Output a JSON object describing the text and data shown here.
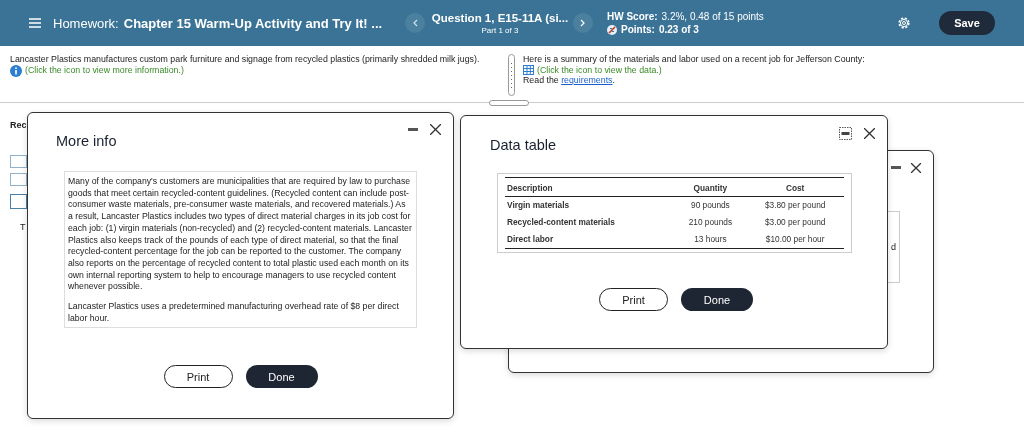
{
  "header": {
    "homework_label": "Homework:",
    "title": "Chapter 15 Warm-Up Activity and Try It! ...",
    "question": "Question 1, E15-11A (si...",
    "part": "Part 1 of 3",
    "score_label": "HW Score:",
    "score": "3.2%, 0.48 of 15 points",
    "points_label": "Points:",
    "points": "0.23 of 3",
    "save": "Save"
  },
  "left_pane": {
    "text": "Lancaster Plastics manufactures custom park furniture and signage from recycled plastics (primarily shredded milk jugs).",
    "hint": "(Click the icon to view more information.)"
  },
  "right_pane": {
    "text": "Here is a summary of the materials and labor used on a recent job for Jefferson County:",
    "hint": "(Click the icon to view the data.)",
    "read_prefix": "Read the ",
    "read_link": "requirements",
    "read_suffix": "."
  },
  "background": {
    "heading": "Rec",
    "answer_boxes": [
      {
        "selected": false
      },
      {
        "selected": false
      },
      {
        "selected": true
      }
    ],
    "label": "T",
    "fragment": "d"
  },
  "more_info": {
    "title": "More info",
    "paragraphs": [
      "Many of the company's customers are municipalities that are required by law to purchase goods that meet certain recycled-content guidelines. (Recycled content can include post-consumer waste materials, pre-consumer waste materials, and recovered materials.) As a result, Lancaster Plastics includes two types of direct material charges in its job cost for each job: (1) virgin materials (non-recycled) and (2) recycled-content materials. Lancaster Plastics also keeps track of the pounds of each type of direct material, so that the final recycled-content percentage for the job can be reported to the customer. The company also reports on the percentage of recycled content to total plastic used each month on its own internal reporting system to help to encourage managers to use recycled content whenever possible.",
      "Lancaster Plastics uses a predetermined manufacturing overhead rate of $8 per direct labor hour."
    ],
    "print": "Print",
    "done": "Done"
  },
  "data_table": {
    "title": "Data table",
    "columns": [
      "Description",
      "Quantity",
      "Cost"
    ],
    "rows": [
      [
        "Virgin materials",
        "90 pounds",
        "$3.80 per pound"
      ],
      [
        "Recycled-content materials",
        "210 pounds",
        "$3.00 per pound"
      ],
      [
        "Direct labor",
        "13 hours",
        "$10.00 per hour"
      ]
    ],
    "print": "Print",
    "done": "Done"
  }
}
